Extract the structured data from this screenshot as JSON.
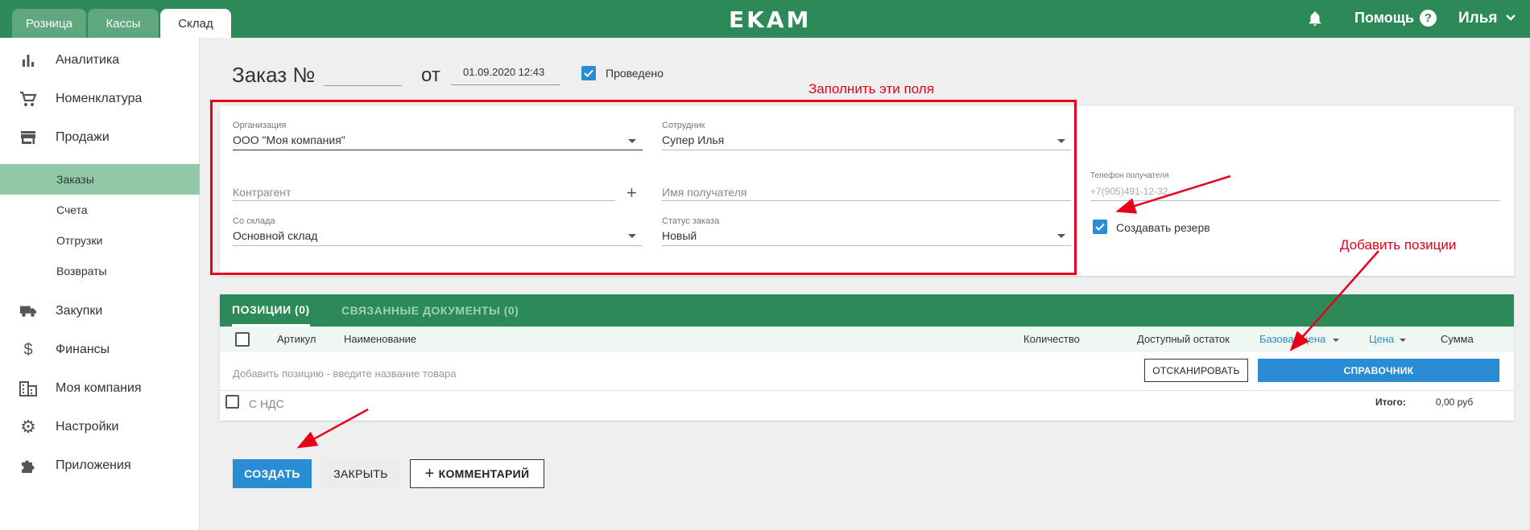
{
  "topbar": {
    "tabs": [
      {
        "label": "Розница"
      },
      {
        "label": "Кассы"
      },
      {
        "label": "Склад"
      }
    ],
    "logo": "EKAM",
    "help_label": "Помощь",
    "help_icon": "?",
    "user_name": "Илья",
    "brand_color": "#2b8a57"
  },
  "sidebar": {
    "items": [
      {
        "label": "Аналитика",
        "icon": "bar-chart-icon"
      },
      {
        "label": "Номенклатура",
        "icon": "cart-icon"
      },
      {
        "label": "Продажи",
        "icon": "store-icon"
      },
      {
        "label": "Закупки",
        "icon": "truck-icon"
      },
      {
        "label": "Финансы",
        "icon": "dollar-icon"
      },
      {
        "label": "Моя компания",
        "icon": "building-icon"
      },
      {
        "label": "Настройки",
        "icon": "gear-icon"
      },
      {
        "label": "Приложения",
        "icon": "puzzle-icon"
      }
    ],
    "sub_items": [
      {
        "label": "Заказы",
        "active": true
      },
      {
        "label": "Счета"
      },
      {
        "label": "Отгрузки"
      },
      {
        "label": "Возвраты"
      }
    ]
  },
  "order": {
    "title": "Заказ №",
    "number": "",
    "from_label": "от",
    "date": "01.09.2020 12:43",
    "posted_label": "Проведено",
    "posted": true
  },
  "form": {
    "organization": {
      "label": "Организация",
      "value": "ООО \"Моя компания\""
    },
    "employee": {
      "label": "Сотрудник",
      "value": "Супер Илья"
    },
    "counterparty": {
      "placeholder": "Контрагент"
    },
    "recipient_name": {
      "placeholder": "Имя получателя"
    },
    "recipient_phone": {
      "label": "Телефон получателя",
      "placeholder": "+7(905)491-12-32"
    },
    "warehouse": {
      "label": "Со склада",
      "value": "Основной склад"
    },
    "status": {
      "label": "Статус заказа",
      "value": "Новый"
    },
    "reserve_label": "Создавать резерв",
    "reserve": true
  },
  "annotations": {
    "fill_fields": "Заполнить эти поля",
    "add_positions": "Добавить позиции",
    "color": "#e8001a"
  },
  "positions": {
    "tab_positions": "ПОЗИЦИИ (0)",
    "tab_related": "СВЯЗАННЫЕ ДОКУМЕНТЫ (0)",
    "columns": {
      "article": "Артикул",
      "name": "Наименование",
      "quantity": "Количество",
      "available": "Доступный остаток",
      "base_price": "Базовая цена",
      "price": "Цена",
      "sum": "Сумма"
    },
    "add_placeholder": "Добавить позицию - введите название товара",
    "scan_button": "ОТСКАНИРОВАТЬ",
    "catalog_button": "СПРАВОЧНИК",
    "vat_label": "С НДС",
    "total_label": "Итого:",
    "total_value": "0,00 руб"
  },
  "actions": {
    "create": "СОЗДАТЬ",
    "close": "ЗАКРЫТЬ",
    "comment": "КОММЕНТАРИЙ",
    "accent": "#2a8dd4"
  }
}
